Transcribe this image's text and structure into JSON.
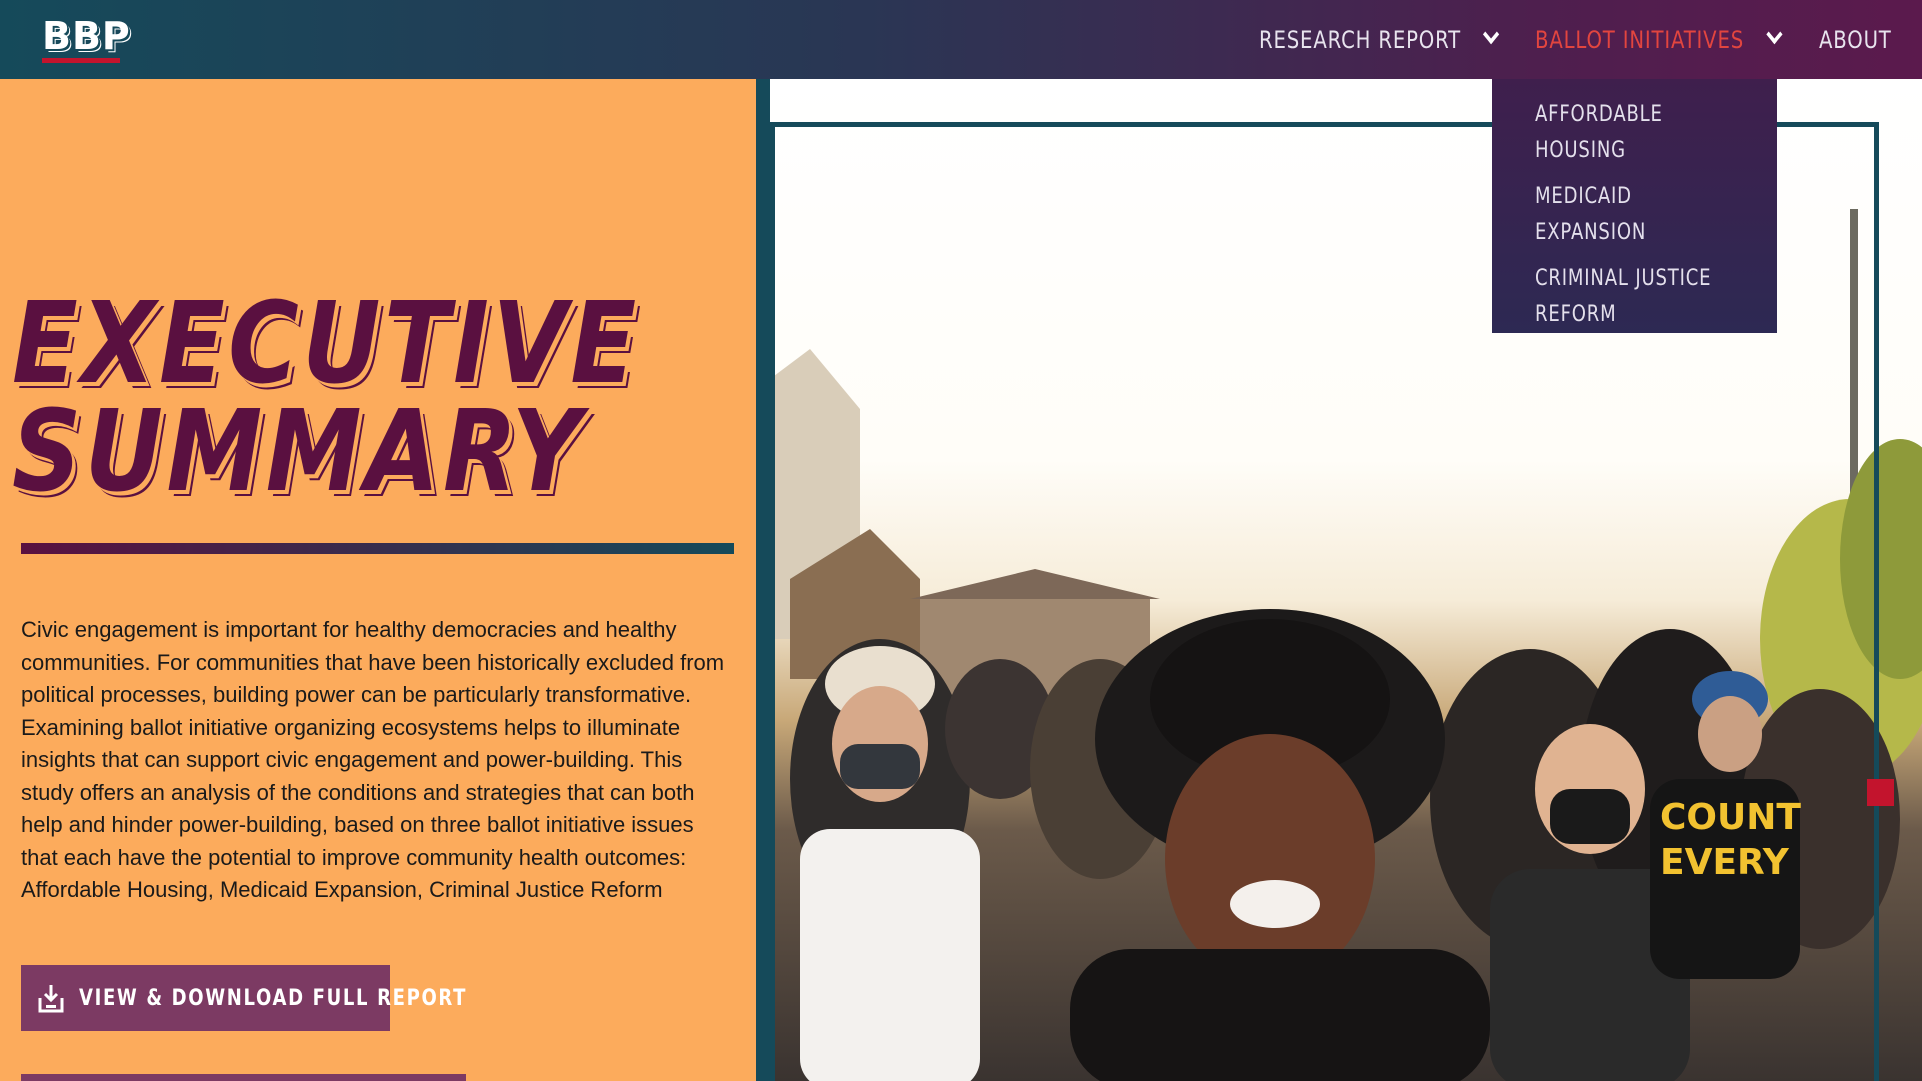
{
  "header": {
    "logo": "BBP",
    "nav": [
      {
        "label": "RESEARCH REPORT"
      },
      {
        "label": "BALLOT INITIATIVES"
      },
      {
        "label": "ABOUT"
      }
    ],
    "active_color": "#e2453f"
  },
  "dropdown": {
    "items": [
      {
        "label": "AFFORDABLE HOUSING"
      },
      {
        "label": "MEDICAID EXPANSION"
      },
      {
        "label": "CRIMINAL JUSTICE REFORM"
      }
    ]
  },
  "main": {
    "title_line1": "EXECUTIVE",
    "title_line2": "SUMMARY",
    "summary": "Civic engagement is important for healthy democracies and healthy communities. For communities that have been historically excluded from political processes, building power can be particularly transformative. Examining ballot initiative organizing ecosystems helps to illuminate insights that can support civic engagement and power-building. This study offers an analysis of the conditions and strategies that can both help and hinder power-building, based on three ballot initiative issues that each have the potential to improve community health outcomes: Affordable Housing, Medicaid Expansion, Criminal Justice Reform",
    "download_label": "VIEW & DOWNLOAD FULL REPORT"
  },
  "colors": {
    "panel": "#fcab5c",
    "title": "#5a1040",
    "teal": "#154a5a",
    "button": "#7c3a63",
    "marker": "#c3142d"
  }
}
